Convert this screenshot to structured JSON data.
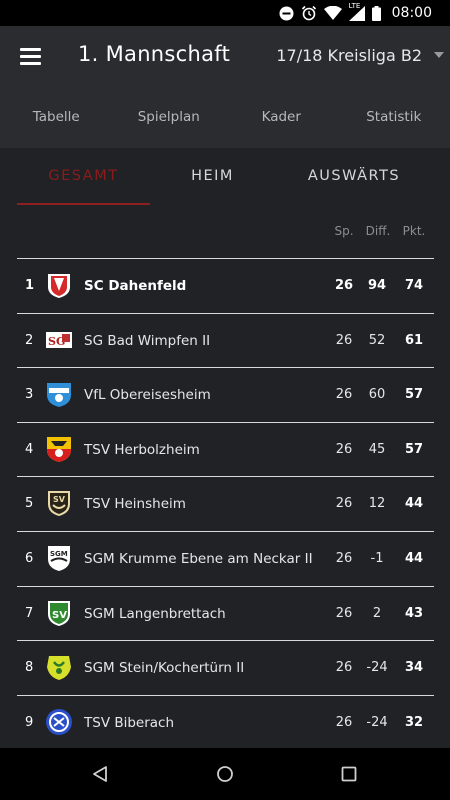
{
  "status_bar": {
    "time": "08:00",
    "network": "LTE",
    "icons": [
      "do-not-disturb-icon",
      "alarm-icon",
      "wifi-icon",
      "signal-icon",
      "battery-icon"
    ]
  },
  "app_bar": {
    "title": "1. Mannschaft",
    "season": "17/18 Kreisliga B2"
  },
  "nav_tabs": [
    "Tabelle",
    "Spielplan",
    "Kader",
    "Statistik"
  ],
  "sub_tabs": {
    "gesamt": "GESAMT",
    "heim": "HEIM",
    "auswaerts": "AUSWÄRTS"
  },
  "columns": {
    "sp": "Sp.",
    "diff": "Diff.",
    "pkt": "Pkt."
  },
  "colors": {
    "accent": "#8e1f1f",
    "background": "#202226",
    "header": "#2b2c30"
  },
  "rows": [
    {
      "rank": "1",
      "team": "SC Dahenfeld",
      "sp": "26",
      "diff": "94",
      "pkt": "74",
      "logo": "red-white-shield-logo"
    },
    {
      "rank": "2",
      "team": "SG Bad Wimpfen II",
      "sp": "26",
      "diff": "52",
      "pkt": "61",
      "logo": "sg-crest-logo"
    },
    {
      "rank": "3",
      "team": "VfL Obereisesheim",
      "sp": "26",
      "diff": "60",
      "pkt": "57",
      "logo": "blue-shield-logo"
    },
    {
      "rank": "4",
      "team": "TSV Herbolzheim",
      "sp": "26",
      "diff": "45",
      "pkt": "57",
      "logo": "yellow-red-crest-logo"
    },
    {
      "rank": "5",
      "team": "TSV Heinsheim",
      "sp": "26",
      "diff": "12",
      "pkt": "44",
      "logo": "gold-crest-logo"
    },
    {
      "rank": "6",
      "team": "SGM Krumme Ebene am Neckar II",
      "sp": "26",
      "diff": "-1",
      "pkt": "44",
      "logo": "white-shield-logo"
    },
    {
      "rank": "7",
      "team": "SGM Langenbrettach",
      "sp": "26",
      "diff": "2",
      "pkt": "43",
      "logo": "green-shield-logo"
    },
    {
      "rank": "8",
      "team": "SGM Stein/Kochertürn II",
      "sp": "26",
      "diff": "-24",
      "pkt": "34",
      "logo": "yellow-green-crest-logo"
    },
    {
      "rank": "9",
      "team": "TSV Biberach",
      "sp": "26",
      "diff": "-24",
      "pkt": "32",
      "logo": "blue-round-logo"
    }
  ]
}
